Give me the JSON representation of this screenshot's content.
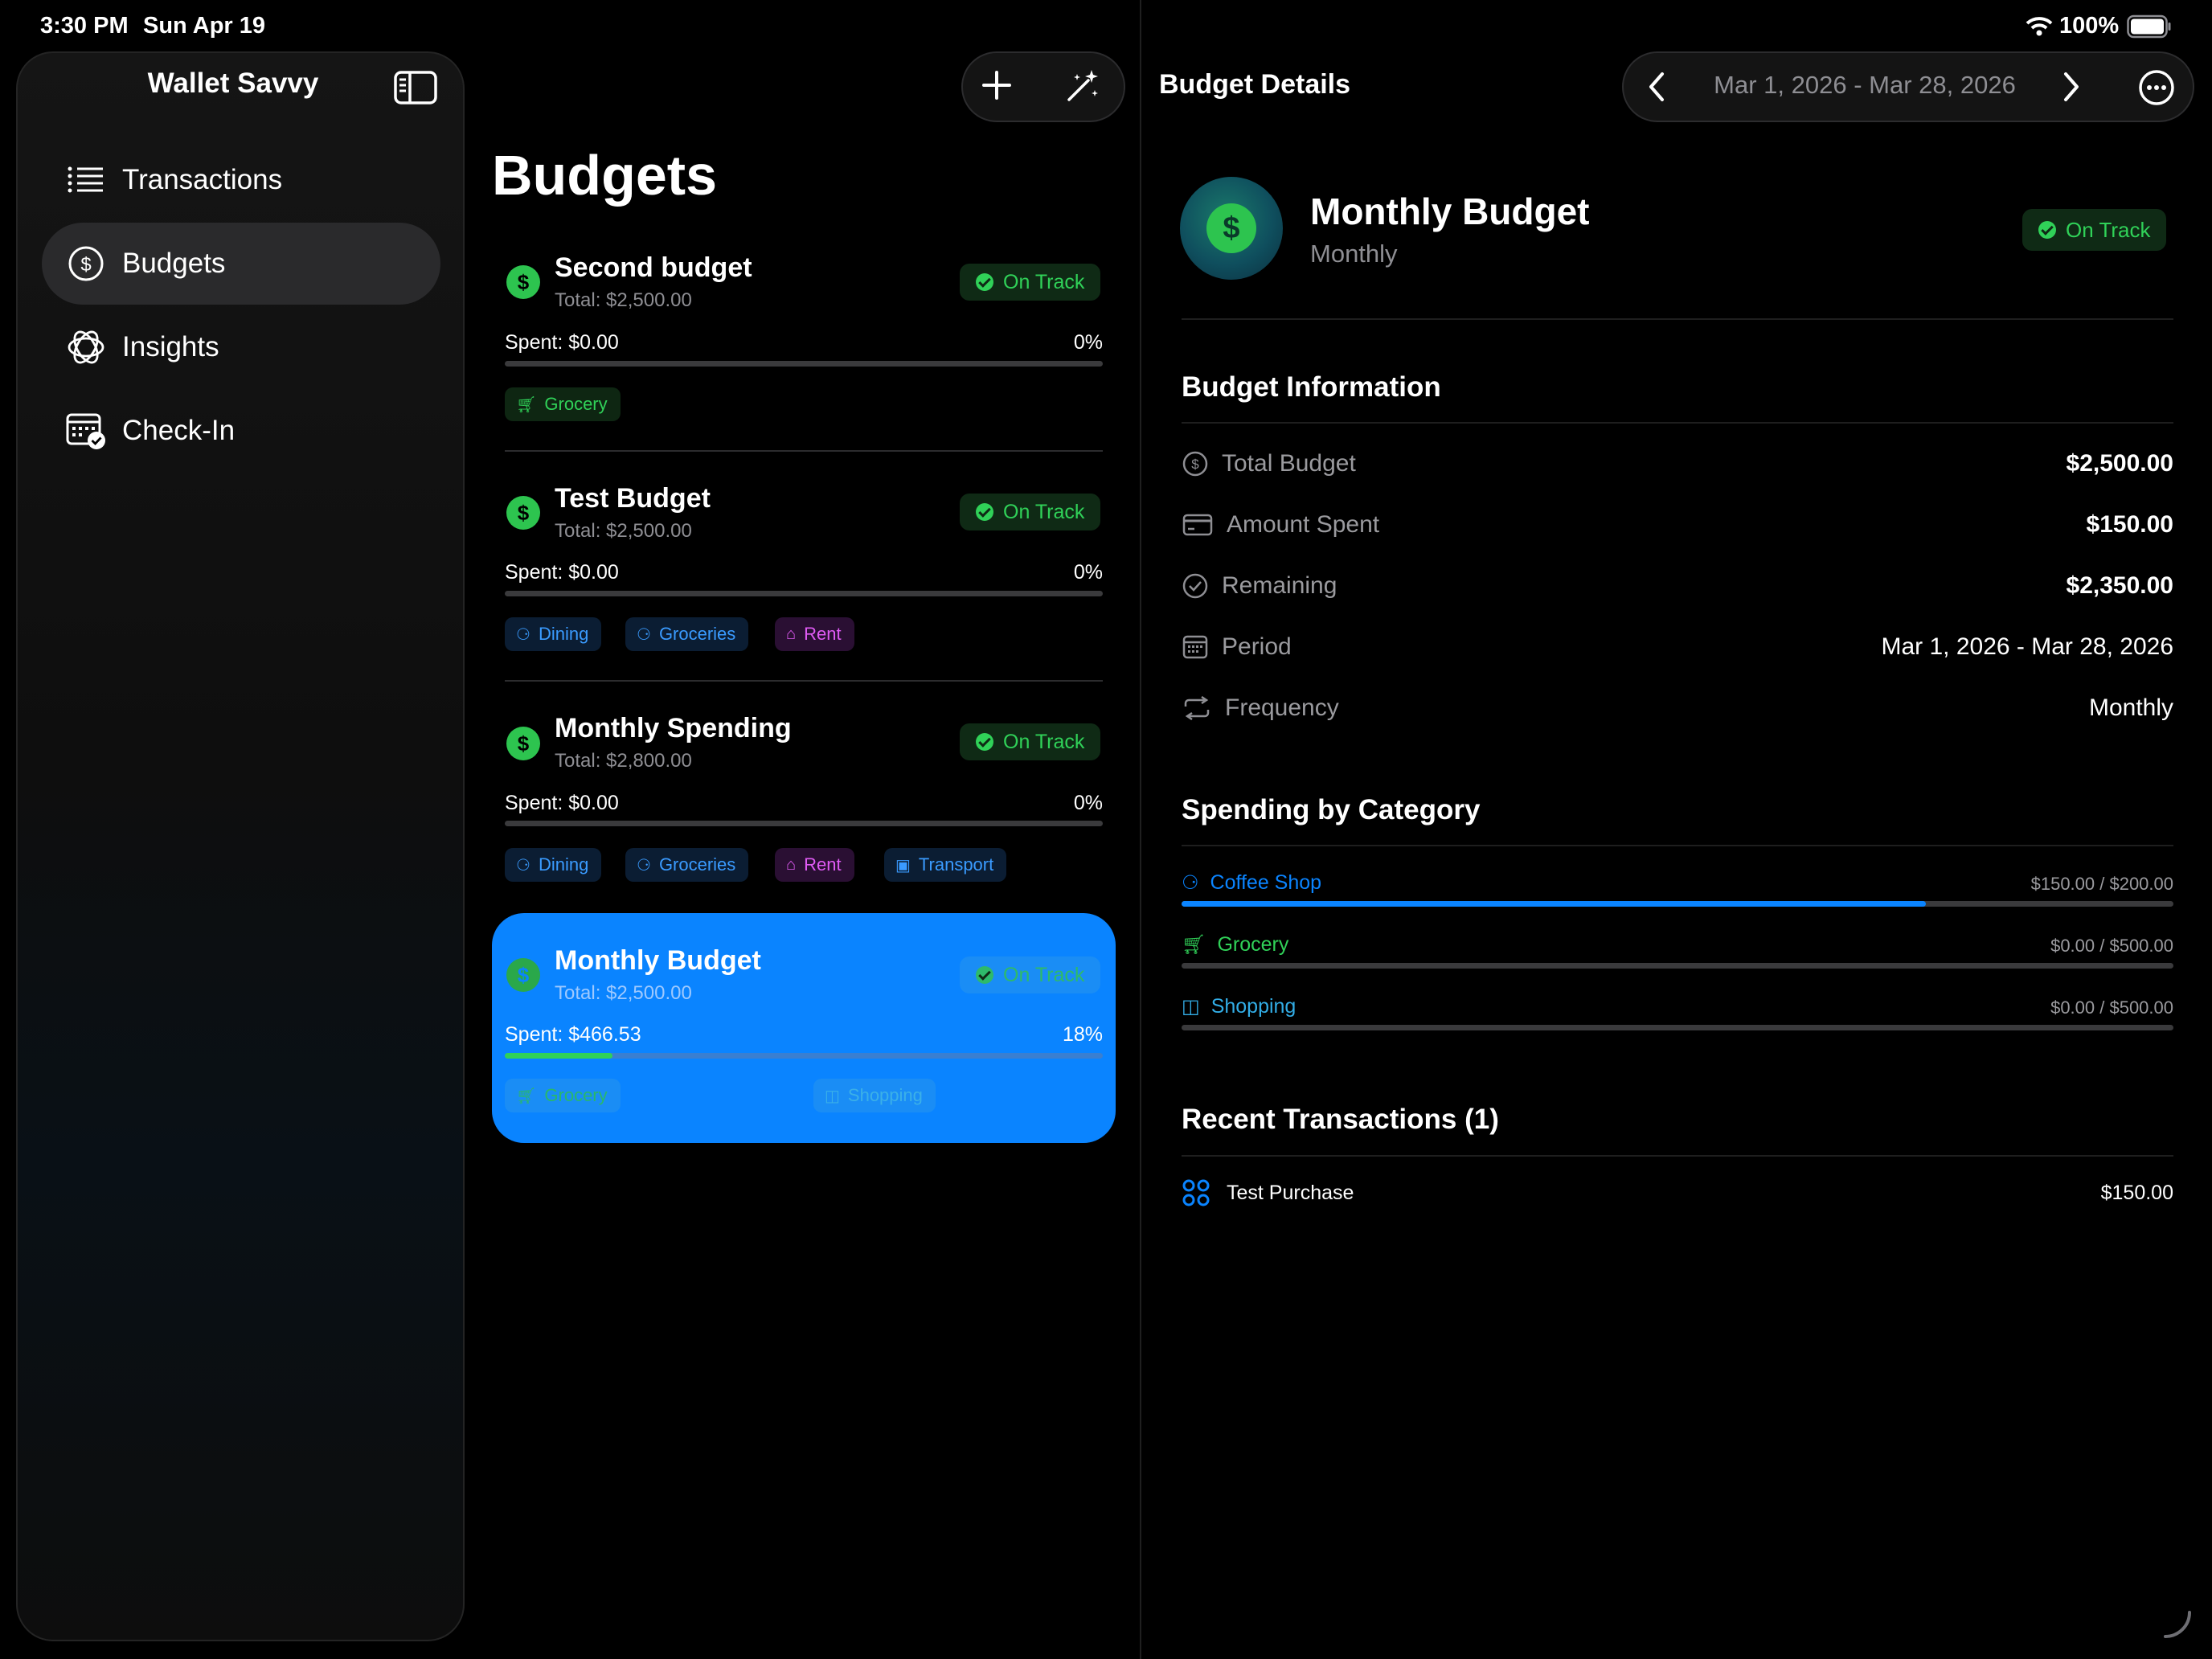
{
  "status_bar": {
    "time": "3:30 PM",
    "date": "Sun Apr 19",
    "battery": "100%"
  },
  "sidebar": {
    "title": "Wallet Savvy",
    "items": [
      {
        "label": "Transactions",
        "icon": "list-icon"
      },
      {
        "label": "Budgets",
        "icon": "dollar-circle-icon",
        "active": true
      },
      {
        "label": "Insights",
        "icon": "insights-icon"
      },
      {
        "label": "Check-In",
        "icon": "calendar-check-icon"
      }
    ]
  },
  "budgets": {
    "title": "Budgets",
    "cards": [
      {
        "name": "Second budget",
        "total": "Total: $2,500.00",
        "status": "On Track",
        "spent": "Spent: $0.00",
        "percent": "0%",
        "progress": 0,
        "chips": [
          {
            "label": "Grocery",
            "style": "green",
            "icon": "cart-icon"
          }
        ]
      },
      {
        "name": "Test Budget",
        "total": "Total: $2,500.00",
        "status": "On Track",
        "spent": "Spent: $0.00",
        "percent": "0%",
        "progress": 0,
        "chips": [
          {
            "label": "Dining",
            "style": "blue",
            "icon": "grid-icon"
          },
          {
            "label": "Groceries",
            "style": "blue",
            "icon": "grid-icon"
          },
          {
            "label": "Rent",
            "style": "purple",
            "icon": "house-icon"
          }
        ]
      },
      {
        "name": "Monthly Spending",
        "total": "Total: $2,800.00",
        "status": "On Track",
        "spent": "Spent: $0.00",
        "percent": "0%",
        "progress": 0,
        "chips": [
          {
            "label": "Dining",
            "style": "blue",
            "icon": "grid-icon"
          },
          {
            "label": "Groceries",
            "style": "blue",
            "icon": "grid-icon"
          },
          {
            "label": "Rent",
            "style": "purple",
            "icon": "house-icon"
          },
          {
            "label": "Transport",
            "style": "blue",
            "icon": "bus-icon"
          }
        ]
      },
      {
        "name": "Monthly Budget",
        "total": "Total: $2,500.00",
        "status": "On Track",
        "spent": "Spent: $466.53",
        "percent": "18%",
        "progress": 0.18,
        "selected": true,
        "chips": [
          {
            "label": "Grocery",
            "style": "green",
            "icon": "cart-icon"
          },
          {
            "label": "Shopping",
            "style": "blue",
            "icon": "bag-icon"
          }
        ]
      }
    ]
  },
  "detail": {
    "title": "Budget Details",
    "date_range": "Mar 1, 2026 - Mar 28, 2026",
    "name": "Monthly Budget",
    "frequency_label": "Monthly",
    "status": "On Track",
    "info_title": "Budget Information",
    "info": [
      {
        "label": "Total Budget",
        "value": "$2,500.00",
        "icon": "dollar-circle-icon"
      },
      {
        "label": "Amount Spent",
        "value": "$150.00",
        "icon": "credit-card-icon"
      },
      {
        "label": "Remaining",
        "value": "$2,350.00",
        "icon": "check-circle-icon"
      },
      {
        "label": "Period",
        "value": "Mar 1, 2026 - Mar 28, 2026",
        "icon": "calendar-icon"
      },
      {
        "label": "Frequency",
        "value": "Monthly",
        "icon": "repeat-icon"
      }
    ],
    "categories_title": "Spending by Category",
    "categories": [
      {
        "label": "Coffee Shop",
        "amount": "$150.00 / $200.00",
        "progress": 0.75,
        "color": "#0a84ff",
        "icon": "grid-icon"
      },
      {
        "label": "Grocery",
        "amount": "$0.00 / $500.00",
        "progress": 0,
        "color": "#30d158",
        "icon": "cart-icon"
      },
      {
        "label": "Shopping",
        "amount": "$0.00 / $500.00",
        "progress": 0,
        "color": "#32ade6",
        "icon": "bag-icon"
      }
    ],
    "transactions_title": "Recent Transactions (1)",
    "transactions": [
      {
        "label": "Test Purchase",
        "amount": "$150.00",
        "icon": "grid-icon"
      }
    ]
  },
  "colors": {
    "accent": "#0a84ff",
    "green": "#30d158",
    "purple": "#e05bf5"
  }
}
